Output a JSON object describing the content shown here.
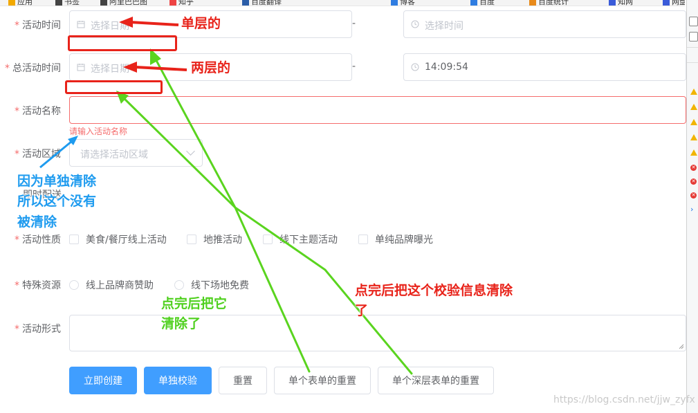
{
  "form": {
    "activity_time": {
      "label": "活动时间",
      "date_placeholder": "选择日期",
      "time_placeholder": "选择时间",
      "range_sep": "-"
    },
    "total_activity_time": {
      "label": "总活动时间",
      "date_placeholder": "选择日期",
      "time_value": "14:09:54",
      "range_sep": "-"
    },
    "activity_name": {
      "label": "活动名称",
      "value": "",
      "error": "请输入活动名称"
    },
    "activity_area": {
      "label": "活动区域",
      "placeholder": "请选择活动区域"
    },
    "peek_label": "即时配送",
    "activity_nature": {
      "label": "活动性质",
      "options": [
        "美食/餐厅线上活动",
        "地推活动",
        "线下主题活动",
        "单纯品牌曝光"
      ]
    },
    "special_resources": {
      "label": "特殊资源",
      "options": [
        "线上品牌商赞助",
        "线下场地免费"
      ]
    },
    "activity_form": {
      "label": "活动形式",
      "value": ""
    },
    "required_mark": "*"
  },
  "buttons": {
    "create": "立即创建",
    "validate_single": "单独校验",
    "reset": "重置",
    "reset_single_form": "单个表单的重置",
    "reset_deep_form": "单个深层表单的重置"
  },
  "annotations": {
    "single_layer": "单层的",
    "two_layers": "两层的",
    "individually_cleared": [
      "因为单独清除",
      "所以这个没有",
      "被清除"
    ],
    "cleared_after_click": [
      "点完后把它",
      "清除了"
    ],
    "clear_validation_msg": [
      "点完后把这个校验信息清除",
      "了"
    ]
  },
  "bookmarks": [
    "应用",
    "书签",
    "阿里巴巴图",
    "知乎",
    "百度翻译",
    "博客",
    "百度",
    "百度统计",
    "知网",
    "网盘"
  ],
  "watermark": "https://blog.csdn.net/jjw_zyfx",
  "colors": {
    "primary": "#409eff",
    "error": "#f56c6c",
    "annotation_red": "#e8231a",
    "annotation_green": "#4fd01e",
    "annotation_blue": "#1e9bef"
  }
}
